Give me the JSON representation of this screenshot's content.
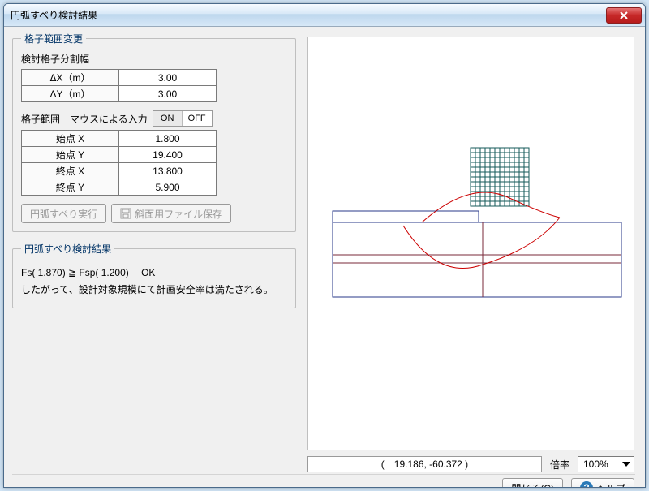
{
  "window": {
    "title": "円弧すべり検討結果"
  },
  "group_range": {
    "legend": "格子範囲変更",
    "grid_division_label": "検討格子分割幅",
    "division": {
      "dx_label": "ΔX（m）",
      "dx_value": "3.00",
      "dy_label": "ΔY（m）",
      "dy_value": "3.00"
    },
    "mouse_label": "格子範囲　マウスによる入力",
    "mouse_on": "ON",
    "mouse_off": "OFF",
    "points": {
      "start_x_label": "始点 X",
      "start_x_value": "1.800",
      "start_y_label": "始点 Y",
      "start_y_value": "19.400",
      "end_x_label": "終点 X",
      "end_x_value": "13.800",
      "end_y_label": "終点 Y",
      "end_y_value": "5.900"
    },
    "execute_button": "円弧すべり実行",
    "save_button": "斜面用ファイル保存"
  },
  "group_result": {
    "legend": "円弧すべり検討結果",
    "line1": "Fs(  1.870) ≧ Fsp(  1.200)　 OK",
    "line2": "したがって、設計対象規模にて計画安全率は満たされる。"
  },
  "plot_status": {
    "coords": "(　19.186, -60.372 )",
    "zoom_label": "倍率",
    "zoom_value": "100%"
  },
  "footer": {
    "close": "閉じる(C)",
    "help": "ヘルプ"
  }
}
